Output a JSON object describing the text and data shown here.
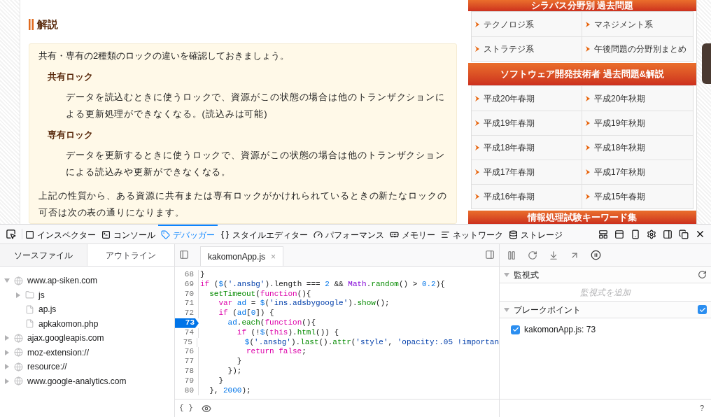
{
  "article": {
    "heading": "解説",
    "intro": "共有・専有の2種類のロックの違いを確認しておきましょう。",
    "terms": [
      {
        "term": "共有ロック",
        "definition": "データを読込むときに使うロックで、資源がこの状態の場合は他のトランザクションによる更新処理ができなくなる。(読込みは可能)"
      },
      {
        "term": "専有ロック",
        "definition": "データを更新するときに使うロックで、資源がこの状態の場合は他のトランザクションによる読込みや更新ができなくなる。"
      }
    ],
    "conclusion": "上記の性質から、ある資源に共有または専有ロックがかけれられているときの新たなロックの可否は次の表の通りになります。"
  },
  "sidebar": {
    "sections": [
      {
        "title": "シラバス分野別 過去問題",
        "links": [
          "テクノロジ系",
          "マネジメント系",
          "ストラテジ系",
          "午後問題の分野別まとめ"
        ]
      },
      {
        "title": "ソフトウェア開発技術者 過去問題&解説",
        "links": [
          "平成20年春期",
          "平成20年秋期",
          "平成19年春期",
          "平成19年秋期",
          "平成18年春期",
          "平成18年秋期",
          "平成17年春期",
          "平成17年秋期",
          "平成16年春期",
          "平成15年春期"
        ]
      },
      {
        "title": "情報処理試験キーワード集"
      }
    ]
  },
  "devtools": {
    "tabs": [
      {
        "label": "インスペクター",
        "selected": false
      },
      {
        "label": "コンソール",
        "selected": false
      },
      {
        "label": "デバッガー",
        "selected": true
      },
      {
        "label": "スタイルエディター",
        "selected": false
      },
      {
        "label": "パフォーマンス",
        "selected": false
      },
      {
        "label": "メモリー",
        "selected": false
      },
      {
        "label": "ネットワーク",
        "selected": false
      },
      {
        "label": "ストレージ",
        "selected": false
      }
    ],
    "sources": {
      "tabs": [
        {
          "label": "ソースファイル",
          "selected": true
        },
        {
          "label": "アウトライン",
          "selected": false
        }
      ],
      "tree": [
        {
          "kind": "domain",
          "label": "www.ap-siken.com",
          "expanded": true,
          "children": [
            {
              "kind": "folder",
              "label": "js",
              "expanded": false
            },
            {
              "kind": "file",
              "label": "ap.js"
            },
            {
              "kind": "file",
              "label": "apkakomon.php"
            }
          ]
        },
        {
          "kind": "domain",
          "label": "ajax.googleapis.com",
          "expanded": false
        },
        {
          "kind": "domain",
          "label": "moz-extension://",
          "expanded": false
        },
        {
          "kind": "domain",
          "label": "resource://",
          "expanded": false
        },
        {
          "kind": "domain",
          "label": "www.google-analytics.com",
          "expanded": false
        }
      ]
    },
    "editor": {
      "file_tab": "kakomonApp.js",
      "close": "×",
      "lines": [
        {
          "number": "68",
          "breakpoint": false,
          "tokens": [
            {
              "kind": "plain",
              "text": "}"
            }
          ]
        },
        {
          "number": "69",
          "breakpoint": false,
          "tokens": [
            {
              "kind": "kw",
              "text": "if"
            },
            {
              "kind": "plain",
              "text": " ("
            },
            {
              "kind": "var",
              "text": "$"
            },
            {
              "kind": "plain",
              "text": "("
            },
            {
              "kind": "str",
              "text": "'.ansbg'"
            },
            {
              "kind": "plain",
              "text": ").length === "
            },
            {
              "kind": "num",
              "text": "2"
            },
            {
              "kind": "plain",
              "text": " && "
            },
            {
              "kind": "builtin",
              "text": "Math"
            },
            {
              "kind": "plain",
              "text": "."
            },
            {
              "kind": "fn",
              "text": "random"
            },
            {
              "kind": "plain",
              "text": "() > "
            },
            {
              "kind": "num",
              "text": "0.2"
            },
            {
              "kind": "plain",
              "text": "){"
            }
          ]
        },
        {
          "number": "70",
          "breakpoint": false,
          "tokens": [
            {
              "kind": "fn",
              "text": "  setTimeout"
            },
            {
              "kind": "plain",
              "text": "("
            },
            {
              "kind": "kw",
              "text": "function"
            },
            {
              "kind": "plain",
              "text": "(){"
            }
          ]
        },
        {
          "number": "71",
          "breakpoint": false,
          "tokens": [
            {
              "kind": "kw",
              "text": "    var"
            },
            {
              "kind": "var",
              "text": " ad"
            },
            {
              "kind": "plain",
              "text": " = "
            },
            {
              "kind": "var",
              "text": "$"
            },
            {
              "kind": "plain",
              "text": "("
            },
            {
              "kind": "str",
              "text": "'ins.adsbygoogle'"
            },
            {
              "kind": "plain",
              "text": ")."
            },
            {
              "kind": "fn",
              "text": "show"
            },
            {
              "kind": "plain",
              "text": "();"
            }
          ]
        },
        {
          "number": "72",
          "breakpoint": false,
          "tokens": [
            {
              "kind": "kw",
              "text": "    if"
            },
            {
              "kind": "plain",
              "text": " ("
            },
            {
              "kind": "var",
              "text": "ad"
            },
            {
              "kind": "plain",
              "text": "["
            },
            {
              "kind": "num",
              "text": "0"
            },
            {
              "kind": "plain",
              "text": "]) {"
            }
          ]
        },
        {
          "number": "73",
          "breakpoint": true,
          "tokens": [
            {
              "kind": "var",
              "text": "      ad"
            },
            {
              "kind": "plain",
              "text": "."
            },
            {
              "kind": "fn",
              "text": "each"
            },
            {
              "kind": "plain",
              "text": "("
            },
            {
              "kind": "kw",
              "text": "function"
            },
            {
              "kind": "plain",
              "text": "(){"
            }
          ]
        },
        {
          "number": "74",
          "breakpoint": false,
          "tokens": [
            {
              "kind": "kw",
              "text": "        if"
            },
            {
              "kind": "plain",
              "text": " (!"
            },
            {
              "kind": "var",
              "text": "$"
            },
            {
              "kind": "plain",
              "text": "("
            },
            {
              "kind": "kw",
              "text": "this"
            },
            {
              "kind": "plain",
              "text": ")."
            },
            {
              "kind": "fn",
              "text": "html"
            },
            {
              "kind": "plain",
              "text": "()) {"
            }
          ]
        },
        {
          "number": "75",
          "breakpoint": false,
          "tokens": [
            {
              "kind": "var",
              "text": "          $"
            },
            {
              "kind": "plain",
              "text": "("
            },
            {
              "kind": "str",
              "text": "'.ansbg'"
            },
            {
              "kind": "plain",
              "text": ")."
            },
            {
              "kind": "fn",
              "text": "last"
            },
            {
              "kind": "plain",
              "text": "()."
            },
            {
              "kind": "fn",
              "text": "attr"
            },
            {
              "kind": "plain",
              "text": "("
            },
            {
              "kind": "str",
              "text": "'style'"
            },
            {
              "kind": "plain",
              "text": ", "
            },
            {
              "kind": "str",
              "text": "'opacity:.05 !importan"
            }
          ]
        },
        {
          "number": "76",
          "breakpoint": false,
          "tokens": [
            {
              "kind": "kw",
              "text": "          return false"
            },
            {
              "kind": "plain",
              "text": ";"
            }
          ]
        },
        {
          "number": "77",
          "breakpoint": false,
          "tokens": [
            {
              "kind": "plain",
              "text": "        }"
            }
          ]
        },
        {
          "number": "78",
          "breakpoint": false,
          "tokens": [
            {
              "kind": "plain",
              "text": "      });"
            }
          ]
        },
        {
          "number": "79",
          "breakpoint": false,
          "tokens": [
            {
              "kind": "plain",
              "text": "    }"
            }
          ]
        },
        {
          "number": "80",
          "breakpoint": false,
          "tokens": [
            {
              "kind": "plain",
              "text": "  }, "
            },
            {
              "kind": "num",
              "text": "2000"
            },
            {
              "kind": "plain",
              "text": ");"
            }
          ]
        }
      ],
      "pretty_print": "{ }"
    },
    "watch": {
      "title": "監視式",
      "placeholder": "監視式を追加"
    },
    "breakpoints": {
      "title": "ブレークポイント",
      "enabled": true,
      "items": [
        {
          "label": "kakomonApp.js: 73",
          "checked": true
        }
      ]
    },
    "help": "?"
  }
}
